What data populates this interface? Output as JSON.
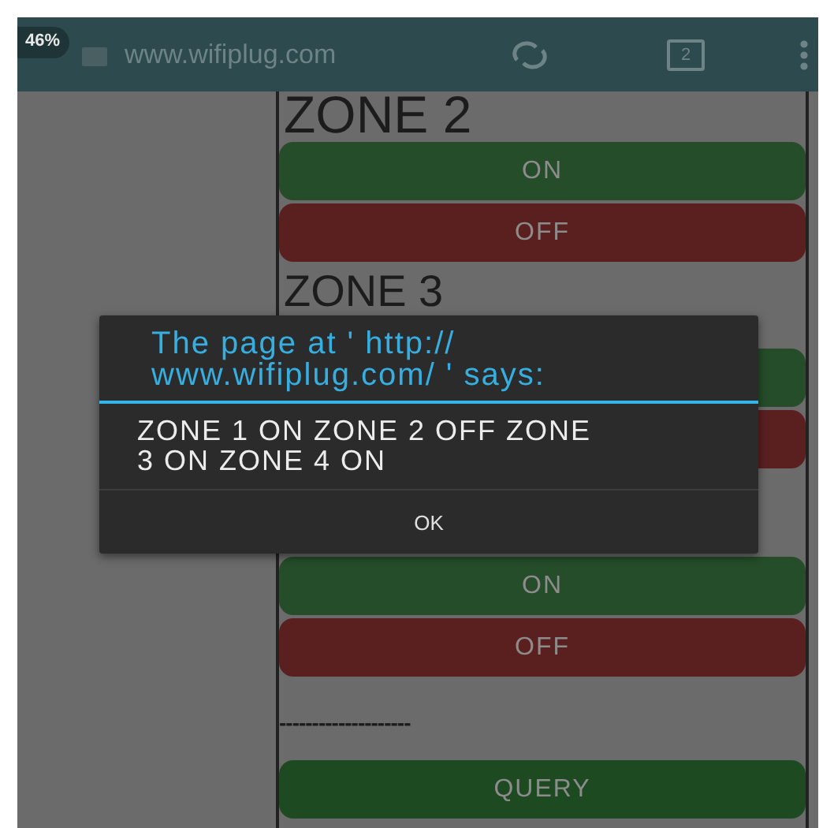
{
  "browser_bar": {
    "zoom_badge": "46%",
    "url": "www.wifiplug.com",
    "tab_count": "2"
  },
  "page_items": [
    {
      "kind": "heading",
      "text": "ZONE 2"
    },
    {
      "kind": "on",
      "text": "ON"
    },
    {
      "kind": "off",
      "text": "OFF"
    },
    {
      "kind": "heading",
      "text": "ZONE 3"
    },
    {
      "kind": "on"
    },
    {
      "kind": "off"
    },
    {
      "kind": "spacer"
    },
    {
      "kind": "on",
      "text": "ON"
    },
    {
      "kind": "off",
      "text": "OFF"
    },
    {
      "kind": "rule",
      "text": "--------------------"
    },
    {
      "kind": "query",
      "text": "QUERY"
    }
  ],
  "dialog": {
    "title": "The page at ' http:// www.wifiplug.com/ ' says:",
    "message": "ZONE 1 ON ZONE 2 OFF ZONE 3 ON ZONE 4 ON",
    "button": "OK"
  }
}
